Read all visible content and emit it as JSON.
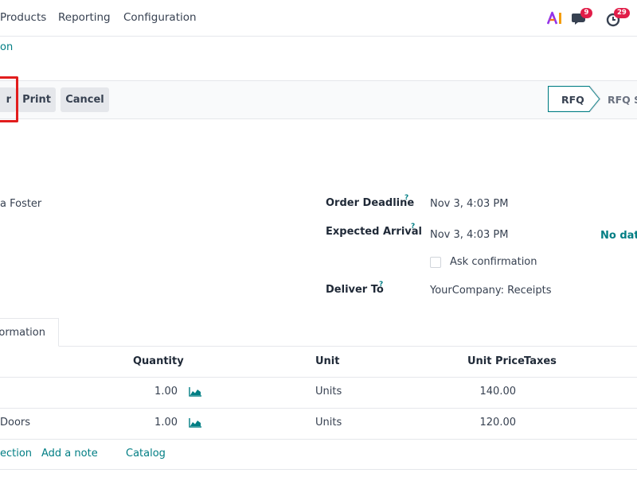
{
  "navbar": {
    "menu": [
      {
        "label": "Products"
      },
      {
        "label": "Reporting"
      },
      {
        "label": "Configuration"
      }
    ],
    "ai_icon": "ai-icon",
    "messages": {
      "icon": "chat-icon",
      "count": "9"
    },
    "activities": {
      "icon": "clock-icon",
      "count": "29"
    }
  },
  "breadcrumb": {
    "label": "on"
  },
  "control_panel": {
    "buttons": {
      "confirm_order": "r",
      "print": "Print",
      "cancel": "Cancel"
    },
    "status": {
      "current": "RFQ",
      "next": "RFQ S"
    }
  },
  "form": {
    "vendor": "a Foster",
    "order_deadline": {
      "label": "Order Deadline",
      "help": "?",
      "value": "Nov 3, 4:03 PM"
    },
    "expected_arrival": {
      "label": "Expected Arrival",
      "help": "?",
      "value": "Nov 3, 4:03 PM",
      "no_data": "No data"
    },
    "ask_confirmation": {
      "label": "Ask confirmation",
      "checked": false
    },
    "deliver_to": {
      "label": "Deliver To",
      "help": "?",
      "value": "YourCompany: Receipts"
    }
  },
  "tabs": {
    "other_info": "formation"
  },
  "order_lines": {
    "headers": {
      "quantity": "Quantity",
      "unit": "Unit",
      "unit_price": "Unit Price",
      "taxes": "Taxes"
    },
    "rows": [
      {
        "product": "",
        "quantity": "1.00",
        "unit": "Units",
        "unit_price": "140.00"
      },
      {
        "product": " Doors",
        "quantity": "1.00",
        "unit": "Units",
        "unit_price": "120.00"
      }
    ],
    "add_links": {
      "section": "ection",
      "note": "Add a note",
      "catalog": "Catalog"
    }
  },
  "colors": {
    "accent": "#017e84",
    "badge": "#e11d48",
    "highlight": "#e11d1d"
  }
}
